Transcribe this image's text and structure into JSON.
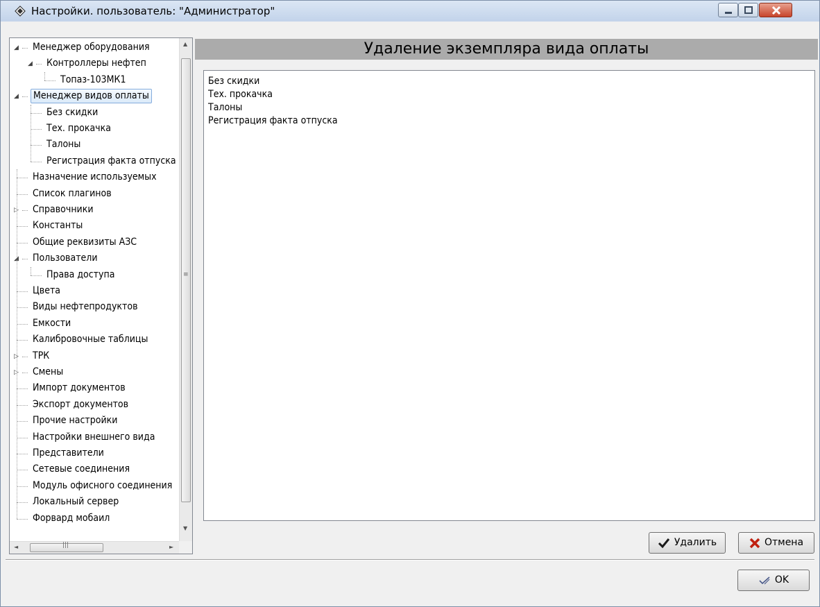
{
  "window": {
    "title": "Настройки. пользователь: \"Администратор\""
  },
  "tree": {
    "items": [
      {
        "label": "Менеджер оборудования",
        "level": 0,
        "toggle": "expanded"
      },
      {
        "label": "Контроллеры нефтеп",
        "level": 1,
        "toggle": "expanded"
      },
      {
        "label": "Топаз-103МК1",
        "level": 2,
        "toggle": "none"
      },
      {
        "label": "Менеджер видов оплаты",
        "level": 0,
        "toggle": "expanded",
        "selected": true
      },
      {
        "label": "Без скидки",
        "level": 1,
        "toggle": "none"
      },
      {
        "label": "Тех. прокачка",
        "level": 1,
        "toggle": "none"
      },
      {
        "label": "Талоны",
        "level": 1,
        "toggle": "none"
      },
      {
        "label": "Регистрация факта отпуска",
        "level": 1,
        "toggle": "none"
      },
      {
        "label": "Назначение используемых",
        "level": 0,
        "toggle": "none"
      },
      {
        "label": "Список плагинов",
        "level": 0,
        "toggle": "none"
      },
      {
        "label": "Справочники",
        "level": 0,
        "toggle": "collapsed"
      },
      {
        "label": "Константы",
        "level": 0,
        "toggle": "none"
      },
      {
        "label": "Общие реквизиты АЗС",
        "level": 0,
        "toggle": "none"
      },
      {
        "label": "Пользователи",
        "level": 0,
        "toggle": "expanded"
      },
      {
        "label": "Права доступа",
        "level": 1,
        "toggle": "none"
      },
      {
        "label": "Цвета",
        "level": 0,
        "toggle": "none"
      },
      {
        "label": "Виды нефтепродуктов",
        "level": 0,
        "toggle": "none"
      },
      {
        "label": "Емкости",
        "level": 0,
        "toggle": "none"
      },
      {
        "label": "Калибровочные таблицы",
        "level": 0,
        "toggle": "none"
      },
      {
        "label": "ТРК",
        "level": 0,
        "toggle": "collapsed"
      },
      {
        "label": "Смены",
        "level": 0,
        "toggle": "collapsed"
      },
      {
        "label": "Импорт документов",
        "level": 0,
        "toggle": "none"
      },
      {
        "label": "Экспорт документов",
        "level": 0,
        "toggle": "none"
      },
      {
        "label": "Прочие настройки",
        "level": 0,
        "toggle": "none"
      },
      {
        "label": "Настройки внешнего вида",
        "level": 0,
        "toggle": "none"
      },
      {
        "label": "Представители",
        "level": 0,
        "toggle": "none"
      },
      {
        "label": "Сетевые соединения",
        "level": 0,
        "toggle": "none"
      },
      {
        "label": "Модуль офисного соединения",
        "level": 0,
        "toggle": "none"
      },
      {
        "label": "Локальный сервер",
        "level": 0,
        "toggle": "none"
      },
      {
        "label": "Форвард мобаил",
        "level": 0,
        "toggle": "none"
      }
    ]
  },
  "panel": {
    "title": "Удаление экземпляра вида оплаты",
    "list_items": [
      "Без скидки",
      "Тех. прокачка",
      "Талоны",
      "Регистрация факта отпуска"
    ]
  },
  "buttons": {
    "delete_label": "Удалить",
    "cancel_label": "Отмена",
    "ok_label": "OK"
  },
  "icons": {
    "app": "diamond-icon",
    "delete": "checkmark-icon",
    "cancel": "red-x-icon",
    "ok": "pencil-check-icon"
  },
  "colors": {
    "header_bar": "#ababab",
    "selection_border": "#84acdd",
    "checkmark": "#1a1a1a",
    "cancel_x": "#c02010"
  }
}
